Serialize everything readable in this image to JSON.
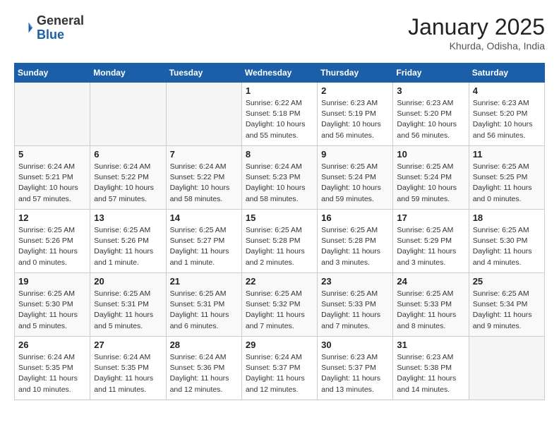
{
  "header": {
    "logo_general": "General",
    "logo_blue": "Blue",
    "month": "January 2025",
    "location": "Khurda, Odisha, India"
  },
  "days_of_week": [
    "Sunday",
    "Monday",
    "Tuesday",
    "Wednesday",
    "Thursday",
    "Friday",
    "Saturday"
  ],
  "weeks": [
    [
      {
        "day": "",
        "sunrise": "",
        "sunset": "",
        "daylight": ""
      },
      {
        "day": "",
        "sunrise": "",
        "sunset": "",
        "daylight": ""
      },
      {
        "day": "",
        "sunrise": "",
        "sunset": "",
        "daylight": ""
      },
      {
        "day": "1",
        "sunrise": "Sunrise: 6:22 AM",
        "sunset": "Sunset: 5:18 PM",
        "daylight": "Daylight: 10 hours and 55 minutes."
      },
      {
        "day": "2",
        "sunrise": "Sunrise: 6:23 AM",
        "sunset": "Sunset: 5:19 PM",
        "daylight": "Daylight: 10 hours and 56 minutes."
      },
      {
        "day": "3",
        "sunrise": "Sunrise: 6:23 AM",
        "sunset": "Sunset: 5:20 PM",
        "daylight": "Daylight: 10 hours and 56 minutes."
      },
      {
        "day": "4",
        "sunrise": "Sunrise: 6:23 AM",
        "sunset": "Sunset: 5:20 PM",
        "daylight": "Daylight: 10 hours and 56 minutes."
      }
    ],
    [
      {
        "day": "5",
        "sunrise": "Sunrise: 6:24 AM",
        "sunset": "Sunset: 5:21 PM",
        "daylight": "Daylight: 10 hours and 57 minutes."
      },
      {
        "day": "6",
        "sunrise": "Sunrise: 6:24 AM",
        "sunset": "Sunset: 5:22 PM",
        "daylight": "Daylight: 10 hours and 57 minutes."
      },
      {
        "day": "7",
        "sunrise": "Sunrise: 6:24 AM",
        "sunset": "Sunset: 5:22 PM",
        "daylight": "Daylight: 10 hours and 58 minutes."
      },
      {
        "day": "8",
        "sunrise": "Sunrise: 6:24 AM",
        "sunset": "Sunset: 5:23 PM",
        "daylight": "Daylight: 10 hours and 58 minutes."
      },
      {
        "day": "9",
        "sunrise": "Sunrise: 6:25 AM",
        "sunset": "Sunset: 5:24 PM",
        "daylight": "Daylight: 10 hours and 59 minutes."
      },
      {
        "day": "10",
        "sunrise": "Sunrise: 6:25 AM",
        "sunset": "Sunset: 5:24 PM",
        "daylight": "Daylight: 10 hours and 59 minutes."
      },
      {
        "day": "11",
        "sunrise": "Sunrise: 6:25 AM",
        "sunset": "Sunset: 5:25 PM",
        "daylight": "Daylight: 11 hours and 0 minutes."
      }
    ],
    [
      {
        "day": "12",
        "sunrise": "Sunrise: 6:25 AM",
        "sunset": "Sunset: 5:26 PM",
        "daylight": "Daylight: 11 hours and 0 minutes."
      },
      {
        "day": "13",
        "sunrise": "Sunrise: 6:25 AM",
        "sunset": "Sunset: 5:26 PM",
        "daylight": "Daylight: 11 hours and 1 minute."
      },
      {
        "day": "14",
        "sunrise": "Sunrise: 6:25 AM",
        "sunset": "Sunset: 5:27 PM",
        "daylight": "Daylight: 11 hours and 1 minute."
      },
      {
        "day": "15",
        "sunrise": "Sunrise: 6:25 AM",
        "sunset": "Sunset: 5:28 PM",
        "daylight": "Daylight: 11 hours and 2 minutes."
      },
      {
        "day": "16",
        "sunrise": "Sunrise: 6:25 AM",
        "sunset": "Sunset: 5:28 PM",
        "daylight": "Daylight: 11 hours and 3 minutes."
      },
      {
        "day": "17",
        "sunrise": "Sunrise: 6:25 AM",
        "sunset": "Sunset: 5:29 PM",
        "daylight": "Daylight: 11 hours and 3 minutes."
      },
      {
        "day": "18",
        "sunrise": "Sunrise: 6:25 AM",
        "sunset": "Sunset: 5:30 PM",
        "daylight": "Daylight: 11 hours and 4 minutes."
      }
    ],
    [
      {
        "day": "19",
        "sunrise": "Sunrise: 6:25 AM",
        "sunset": "Sunset: 5:30 PM",
        "daylight": "Daylight: 11 hours and 5 minutes."
      },
      {
        "day": "20",
        "sunrise": "Sunrise: 6:25 AM",
        "sunset": "Sunset: 5:31 PM",
        "daylight": "Daylight: 11 hours and 5 minutes."
      },
      {
        "day": "21",
        "sunrise": "Sunrise: 6:25 AM",
        "sunset": "Sunset: 5:31 PM",
        "daylight": "Daylight: 11 hours and 6 minutes."
      },
      {
        "day": "22",
        "sunrise": "Sunrise: 6:25 AM",
        "sunset": "Sunset: 5:32 PM",
        "daylight": "Daylight: 11 hours and 7 minutes."
      },
      {
        "day": "23",
        "sunrise": "Sunrise: 6:25 AM",
        "sunset": "Sunset: 5:33 PM",
        "daylight": "Daylight: 11 hours and 7 minutes."
      },
      {
        "day": "24",
        "sunrise": "Sunrise: 6:25 AM",
        "sunset": "Sunset: 5:33 PM",
        "daylight": "Daylight: 11 hours and 8 minutes."
      },
      {
        "day": "25",
        "sunrise": "Sunrise: 6:25 AM",
        "sunset": "Sunset: 5:34 PM",
        "daylight": "Daylight: 11 hours and 9 minutes."
      }
    ],
    [
      {
        "day": "26",
        "sunrise": "Sunrise: 6:24 AM",
        "sunset": "Sunset: 5:35 PM",
        "daylight": "Daylight: 11 hours and 10 minutes."
      },
      {
        "day": "27",
        "sunrise": "Sunrise: 6:24 AM",
        "sunset": "Sunset: 5:35 PM",
        "daylight": "Daylight: 11 hours and 11 minutes."
      },
      {
        "day": "28",
        "sunrise": "Sunrise: 6:24 AM",
        "sunset": "Sunset: 5:36 PM",
        "daylight": "Daylight: 11 hours and 12 minutes."
      },
      {
        "day": "29",
        "sunrise": "Sunrise: 6:24 AM",
        "sunset": "Sunset: 5:37 PM",
        "daylight": "Daylight: 11 hours and 12 minutes."
      },
      {
        "day": "30",
        "sunrise": "Sunrise: 6:23 AM",
        "sunset": "Sunset: 5:37 PM",
        "daylight": "Daylight: 11 hours and 13 minutes."
      },
      {
        "day": "31",
        "sunrise": "Sunrise: 6:23 AM",
        "sunset": "Sunset: 5:38 PM",
        "daylight": "Daylight: 11 hours and 14 minutes."
      },
      {
        "day": "",
        "sunrise": "",
        "sunset": "",
        "daylight": ""
      }
    ]
  ]
}
